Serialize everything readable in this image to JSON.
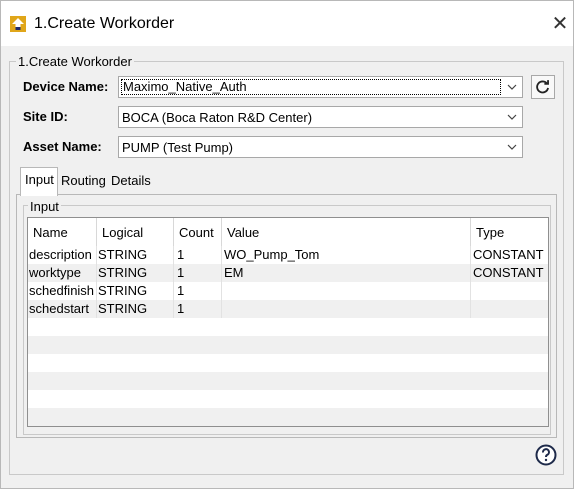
{
  "window": {
    "title": "1.Create Workorder"
  },
  "group": {
    "label": "1.Create Workorder"
  },
  "form": {
    "device_label": "Device Name:",
    "device_value": "Maximo_Native_Auth",
    "site_label": "Site ID:",
    "site_value": "BOCA (Boca Raton R&D Center)",
    "asset_label": "Asset Name:",
    "asset_value": "PUMP (Test Pump)"
  },
  "tabs": [
    {
      "label": "Input"
    },
    {
      "label": "Routing"
    },
    {
      "label": "Details"
    }
  ],
  "input_group": {
    "label": "Input"
  },
  "table": {
    "columns": [
      "Name",
      "Logical",
      "Count",
      "Value",
      "Type"
    ],
    "rows": [
      [
        "description",
        "STRING",
        "1",
        "WO_Pump_Tom",
        "CONSTANT"
      ],
      [
        "worktype",
        "STRING",
        "1",
        "EM",
        "CONSTANT"
      ],
      [
        "schedfinish",
        "STRING",
        "1",
        "",
        ""
      ],
      [
        "schedstart",
        "STRING",
        "1",
        "",
        ""
      ]
    ]
  },
  "icons": {
    "app": "app-logo-icon",
    "close": "close-icon",
    "refresh": "refresh-icon",
    "dropdown": "chevron-down-icon",
    "help": "help-icon"
  }
}
